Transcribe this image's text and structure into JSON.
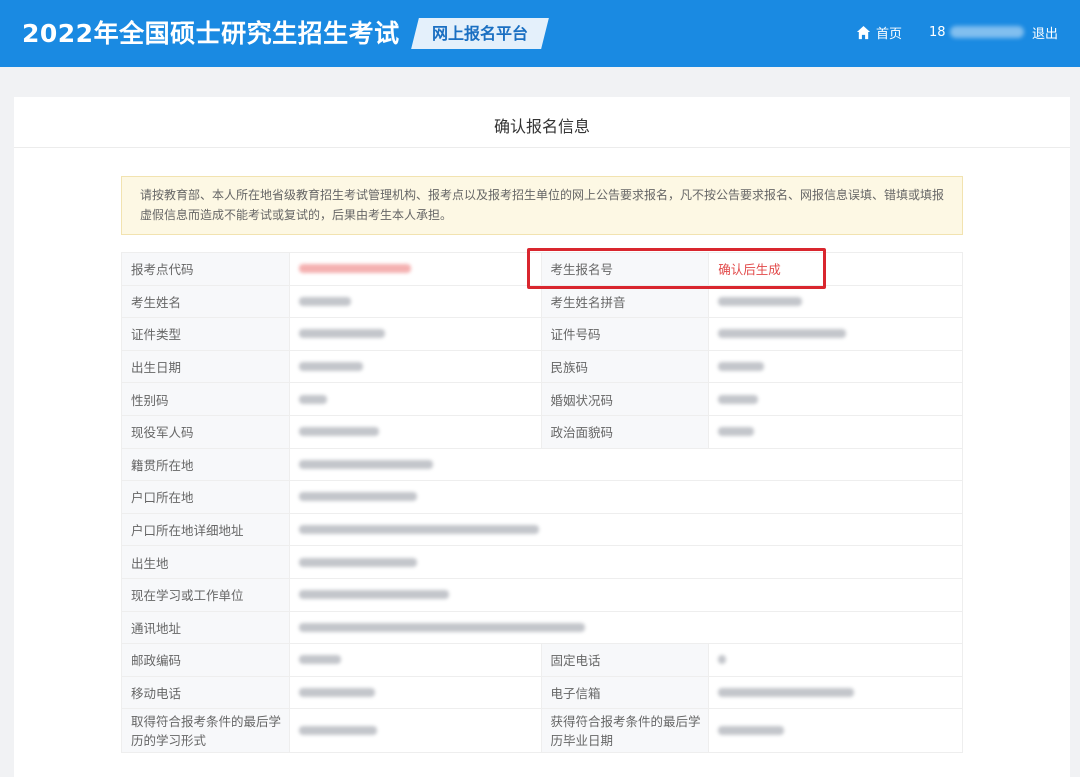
{
  "header": {
    "site_title": "2022年全国硕士研究生招生考试",
    "platform_label": "网上报名平台",
    "home_label": "首页",
    "user_id_prefix": "18",
    "logout_label": "退出"
  },
  "page": {
    "title": "确认报名信息",
    "notice": "请按教育部、本人所在地省级教育招生考试管理机构、报考点以及报考招生单位的网上公告要求报名，凡不按公告要求报名、网报信息误填、错填或填报虚假信息而造成不能考试或复试的，后果由考生本人承担。"
  },
  "table": {
    "rows": [
      {
        "label": "报考点代码",
        "label2": "考生报名号",
        "value2": "确认后生成"
      },
      {
        "label": "考生姓名",
        "label2": "考生姓名拼音"
      },
      {
        "label": "证件类型",
        "label2": "证件号码"
      },
      {
        "label": "出生日期",
        "label2": "民族码"
      },
      {
        "label": "性别码",
        "label2": "婚姻状况码"
      },
      {
        "label": "现役军人码",
        "label2": "政治面貌码"
      },
      {
        "label": "籍贯所在地"
      },
      {
        "label": "户口所在地"
      },
      {
        "label": "户口所在地详细地址"
      },
      {
        "label": "出生地"
      },
      {
        "label": "现在学习或工作单位"
      },
      {
        "label": "通讯地址"
      },
      {
        "label": "邮政编码",
        "label2": "固定电话"
      },
      {
        "label": "移动电话",
        "label2": "电子信箱"
      },
      {
        "label": "取得符合报考条件的最后学历的学习形式",
        "label2": "获得符合报考条件的最后学历毕业日期"
      }
    ]
  },
  "colors": {
    "header_bg": "#1a8ae2",
    "highlight_border": "#d9262e",
    "pending_text": "#e24a4a"
  },
  "icons": {
    "home": "home-icon"
  }
}
